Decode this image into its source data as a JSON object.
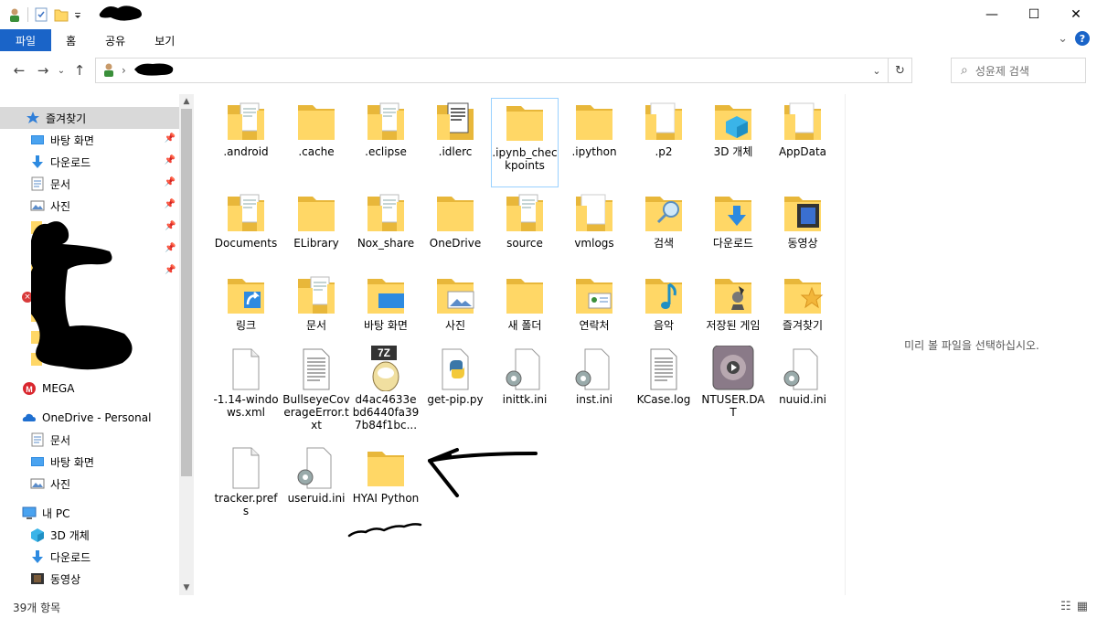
{
  "window": {
    "title": ""
  },
  "titlebar_controls": {
    "minimize": "—",
    "maximize": "☐",
    "close": "✕"
  },
  "ribbon": {
    "tabs": [
      {
        "label": "파일"
      },
      {
        "label": "홈"
      },
      {
        "label": "공유"
      },
      {
        "label": "보기"
      }
    ],
    "expand": "⌄",
    "help": "?"
  },
  "navbar": {
    "back": "←",
    "forward": "→",
    "recent": "⌄",
    "up": "↑",
    "breadcrumb_sep": "›",
    "dropdown": "⌄",
    "refresh": "↻"
  },
  "search": {
    "icon": "⌕",
    "placeholder": "성윤제 검색"
  },
  "sidebar": {
    "items": [
      {
        "label": "즐겨찾기",
        "icon": "star-icon",
        "selected": true
      },
      {
        "label": "바탕 화면",
        "icon": "desktop-icon",
        "pinned": true
      },
      {
        "label": "다운로드",
        "icon": "download-icon",
        "pinned": true
      },
      {
        "label": "문서",
        "icon": "document-icon",
        "pinned": true
      },
      {
        "label": "사진",
        "icon": "picture-icon",
        "pinned": true
      },
      {
        "label": "MEGA",
        "icon": "mega-icon"
      },
      {
        "label": "OneDrive - Personal",
        "icon": "cloud-icon"
      },
      {
        "label": "문서",
        "icon": "document-icon"
      },
      {
        "label": "바탕 화면",
        "icon": "desktop-icon"
      },
      {
        "label": "사진",
        "icon": "picture-icon"
      },
      {
        "label": "내 PC",
        "icon": "pc-icon"
      },
      {
        "label": "3D 개체",
        "icon": "cube-icon"
      },
      {
        "label": "다운로드",
        "icon": "download-icon"
      },
      {
        "label": "동영상",
        "icon": "video-icon"
      }
    ],
    "pin": "📌",
    "scroll_up": "▲",
    "scroll_down": "▼"
  },
  "files": [
    {
      "name": ".android",
      "type": "folder-doc"
    },
    {
      "name": ".cache",
      "type": "folder"
    },
    {
      "name": ".eclipse",
      "type": "folder-doc"
    },
    {
      "name": ".idlerc",
      "type": "folder-dark"
    },
    {
      "name": ".ipynb_checkpoints",
      "type": "folder",
      "selected": true
    },
    {
      "name": ".ipython",
      "type": "folder"
    },
    {
      "name": ".p2",
      "type": "folder-white"
    },
    {
      "name": "3D 개체",
      "type": "folder-3d"
    },
    {
      "name": "AppData",
      "type": "folder-white"
    },
    {
      "name": "Documents",
      "type": "folder-doc"
    },
    {
      "name": "ELibrary",
      "type": "folder"
    },
    {
      "name": "Nox_share",
      "type": "folder-doc"
    },
    {
      "name": "OneDrive",
      "type": "folder"
    },
    {
      "name": "source",
      "type": "folder-doc"
    },
    {
      "name": "vmlogs",
      "type": "folder-white"
    },
    {
      "name": "검색",
      "type": "folder-search"
    },
    {
      "name": "다운로드",
      "type": "folder-download"
    },
    {
      "name": "동영상",
      "type": "folder-video"
    },
    {
      "name": "링크",
      "type": "folder-link"
    },
    {
      "name": "문서",
      "type": "folder-doc"
    },
    {
      "name": "바탕 화면",
      "type": "folder-desktop"
    },
    {
      "name": "사진",
      "type": "folder-picture"
    },
    {
      "name": "새 폴더",
      "type": "folder"
    },
    {
      "name": "연락처",
      "type": "folder-contact"
    },
    {
      "name": "음악",
      "type": "folder-music"
    },
    {
      "name": "저장된 게임",
      "type": "folder-game"
    },
    {
      "name": "즐겨찾기",
      "type": "folder-star"
    },
    {
      "name": "-1.14-windows.xml",
      "type": "file"
    },
    {
      "name": "BullseyeCoverageError.txt",
      "type": "text"
    },
    {
      "name": "d4ac4633ebd6440fa397b84f1bc...",
      "type": "7z"
    },
    {
      "name": "get-pip.py",
      "type": "python"
    },
    {
      "name": "inittk.ini",
      "type": "ini"
    },
    {
      "name": "inst.ini",
      "type": "ini"
    },
    {
      "name": "KCase.log",
      "type": "text"
    },
    {
      "name": "NTUSER.DAT",
      "type": "media"
    },
    {
      "name": "nuuid.ini",
      "type": "ini"
    },
    {
      "name": "tracker.prefs",
      "type": "file"
    },
    {
      "name": "useruid.ini",
      "type": "ini"
    },
    {
      "name": "HYAI Python",
      "type": "folder"
    }
  ],
  "seven_zip_badge": "7Z",
  "preview": {
    "message": "미리 볼 파일을 선택하십시오."
  },
  "status": {
    "count": "39개 항목",
    "view_details": "☷",
    "view_large": "▦"
  },
  "colors": {
    "folder": "#ffd766",
    "folder_dark": "#e8b73a",
    "accent": "#1a64c8",
    "selection": "#cce8ff",
    "selection_border": "#99d1ff"
  }
}
